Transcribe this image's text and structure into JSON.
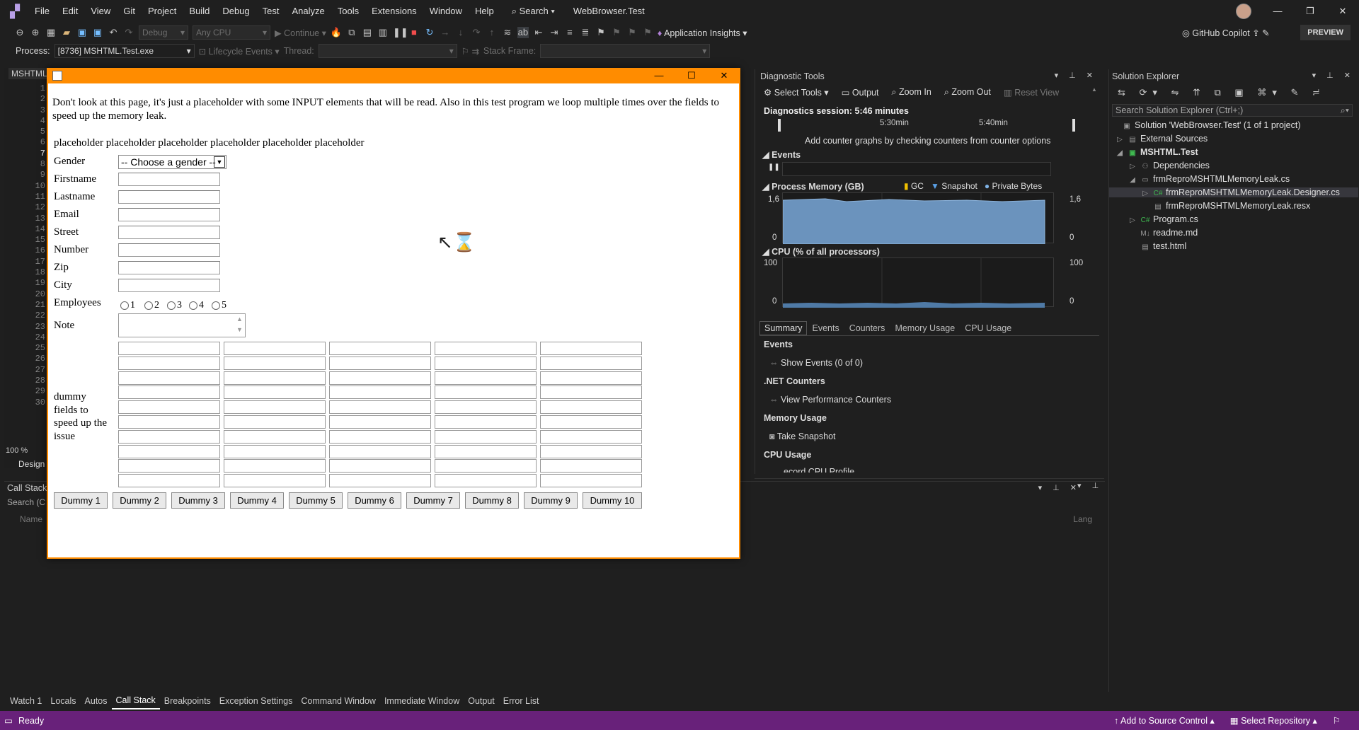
{
  "menu": [
    "File",
    "Edit",
    "View",
    "Git",
    "Project",
    "Build",
    "Debug",
    "Test",
    "Analyze",
    "Tools",
    "Extensions",
    "Window",
    "Help"
  ],
  "search_label": "Search",
  "app_title": "WebBrowser.Test",
  "toolbar": {
    "config": "Debug",
    "platform": "Any CPU",
    "continue": "Continue",
    "app_insights": "Application Insights",
    "copilot": "GitHub Copilot",
    "preview": "PREVIEW"
  },
  "procbar": {
    "process_label": "Process:",
    "process_value": "[8736] MSHTML.Test.exe",
    "lifecycle": "Lifecycle Events",
    "thread": "Thread:",
    "stack_frame": "Stack Frame:"
  },
  "editor": {
    "tab": "MSHTML",
    "zoom": "100 %",
    "design": "Design",
    "lines": [
      "1",
      "2",
      "3",
      "4",
      "5",
      "6",
      "7",
      "8",
      "9",
      "10",
      "11",
      "12",
      "13",
      "14",
      "15",
      "16",
      "17",
      "18",
      "19",
      "20",
      "21",
      "22",
      "23",
      "24",
      "25",
      "26",
      "27",
      "28",
      "29",
      "30"
    ]
  },
  "web": {
    "intro": "Don't look at this page, it's just a placeholder with some INPUT elements that will be read. Also in this test program we loop multiple times over the fields to speed up the memory leak.",
    "placeholder": "placeholder placeholder placeholder placeholder placeholder placeholder",
    "gender_label": "Gender",
    "gender_select": "-- Choose a gender --",
    "fields": [
      "Firstname",
      "Lastname",
      "Email",
      "Street",
      "Number",
      "Zip",
      "City"
    ],
    "employees_label": "Employees",
    "employees": [
      "1",
      "2",
      "3",
      "4",
      "5"
    ],
    "note_label": "Note",
    "dummy_text": "dummy fields to speed up the issue",
    "buttons": [
      "Dummy 1",
      "Dummy 2",
      "Dummy 3",
      "Dummy 4",
      "Dummy 5",
      "Dummy 6",
      "Dummy 7",
      "Dummy 8",
      "Dummy 9",
      "Dummy 10"
    ]
  },
  "diag": {
    "title": "Diagnostic Tools",
    "select_tools": "Select Tools",
    "output": "Output",
    "zoom_in": "Zoom In",
    "zoom_out": "Zoom Out",
    "reset_view": "Reset View",
    "session": "Diagnostics session: 5:46 minutes",
    "t1": "5:30min",
    "t2": "5:40min",
    "add_counter": "Add counter graphs by checking counters from counter options",
    "events": "Events",
    "process_memory": "Process Memory (GB)",
    "gc": "GC",
    "snapshot": "Snapshot",
    "private_bytes": "Private Bytes",
    "mem_max": "1,6",
    "mem_min": "0",
    "cpu": "CPU (% of all processors)",
    "cpu_max": "100",
    "cpu_min": "0",
    "tabs": [
      "Summary",
      "Events",
      "Counters",
      "Memory Usage",
      "CPU Usage"
    ],
    "sum_events": "Events",
    "show_events": "Show Events (0 of 0)",
    "net_counters": ".NET Counters",
    "view_perf": "View Performance Counters",
    "memory_usage": "Memory Usage",
    "take_snapshot": "Take Snapshot",
    "cpu_usage": "CPU Usage",
    "record_cpu": "Record CPU Profile"
  },
  "solution": {
    "title": "Solution Explorer",
    "search": "Search Solution Explorer (Ctrl+;)",
    "items": [
      "Solution 'WebBrowser.Test' (1 of 1 project)",
      "External Sources",
      "MSHTML.Test",
      "Dependencies",
      "frmReproMSHTMLMemoryLeak.cs",
      "frmReproMSHTMLMemoryLeak.Designer.cs",
      "frmReproMSHTMLMemoryLeak.resx",
      "Program.cs",
      "readme.md",
      "test.html"
    ]
  },
  "callstack": {
    "title": "Call Stack",
    "search": "Search (C",
    "name_col": "Name",
    "lang_col": "Lang"
  },
  "bottom_tabs": [
    "Watch 1",
    "Locals",
    "Autos",
    "Call Stack",
    "Breakpoints",
    "Exception Settings",
    "Command Window",
    "Immediate Window",
    "Output",
    "Error List"
  ],
  "status": {
    "ready": "Ready",
    "add_source": "Add to Source Control",
    "select_repo": "Select Repository"
  }
}
